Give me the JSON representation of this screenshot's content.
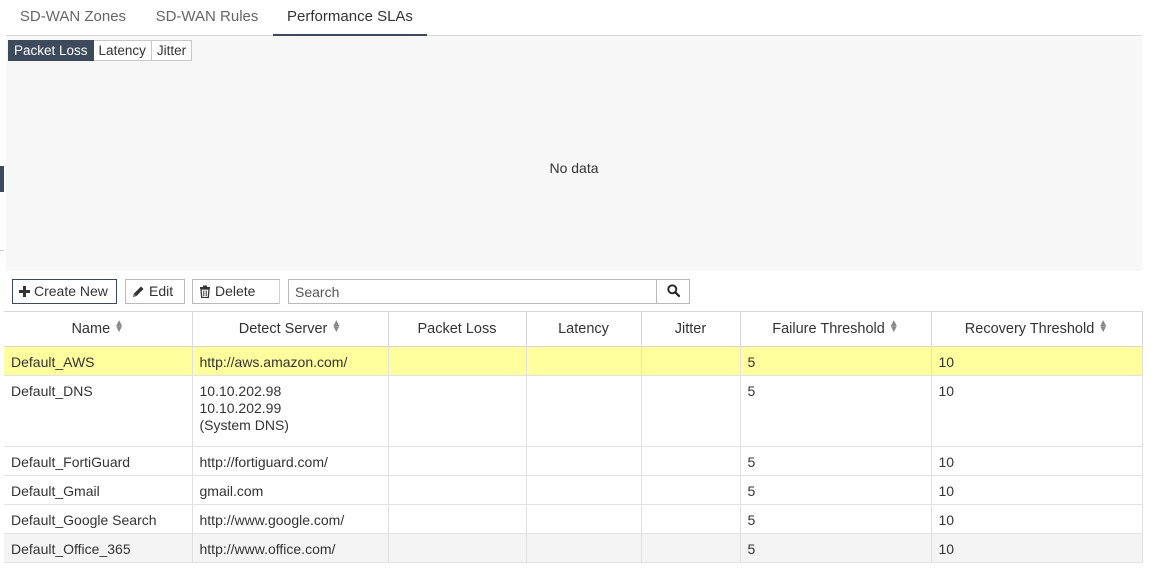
{
  "top_tabs": [
    "SD-WAN Zones",
    "SD-WAN Rules",
    "Performance SLAs"
  ],
  "chart_subtabs": [
    "Packet Loss",
    "Latency",
    "Jitter"
  ],
  "chart_message": "No data",
  "toolbar": {
    "create_label": "Create New",
    "edit_label": "Edit",
    "delete_label": "Delete",
    "search_placeholder": "Search"
  },
  "table": {
    "columns": [
      "Name",
      "Detect Server",
      "Packet Loss",
      "Latency",
      "Jitter",
      "Failure Threshold",
      "Recovery Threshold"
    ],
    "rows": [
      {
        "name": "Default_AWS",
        "server": [
          "http://aws.amazon.com/"
        ],
        "packet_loss": "",
        "latency": "",
        "jitter": "",
        "failure": "5",
        "recovery": "10"
      },
      {
        "name": "Default_DNS",
        "server": [
          "10.10.202.98",
          "10.10.202.99",
          "(System DNS)"
        ],
        "packet_loss": "",
        "latency": "",
        "jitter": "",
        "failure": "5",
        "recovery": "10"
      },
      {
        "name": "Default_FortiGuard",
        "server": [
          "http://fortiguard.com/"
        ],
        "packet_loss": "",
        "latency": "",
        "jitter": "",
        "failure": "5",
        "recovery": "10"
      },
      {
        "name": "Default_Gmail",
        "server": [
          "gmail.com"
        ],
        "packet_loss": "",
        "latency": "",
        "jitter": "",
        "failure": "5",
        "recovery": "10"
      },
      {
        "name": "Default_Google Search",
        "server": [
          "http://www.google.com/"
        ],
        "packet_loss": "",
        "latency": "",
        "jitter": "",
        "failure": "5",
        "recovery": "10"
      },
      {
        "name": "Default_Office_365",
        "server": [
          "http://www.office.com/"
        ],
        "packet_loss": "",
        "latency": "",
        "jitter": "",
        "failure": "5",
        "recovery": "10"
      }
    ]
  },
  "colors": {
    "accent": "#3c4a5c",
    "selected_row": "#ffff9e",
    "chart_background": "#f7f7f8"
  }
}
